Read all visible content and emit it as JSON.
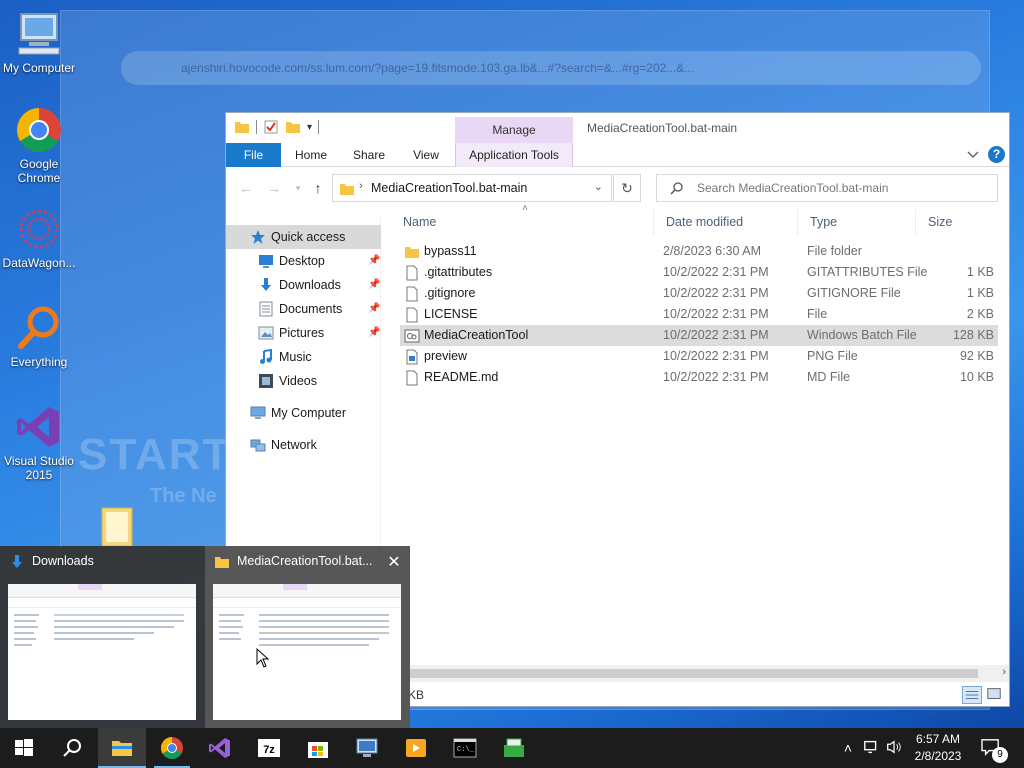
{
  "background": {
    "url_text": "ajenshiri.hovocode.com/ss.lum.com/?page=19.fitsmode.103.ga.lb&...#?search=&...#rg=202...&...",
    "watermark_line1": "START",
    "watermark_line2": "The Ne"
  },
  "desktop_icons": [
    {
      "label": "My Computer",
      "icon": "computer-icon"
    },
    {
      "label": "Google Chrome",
      "icon": "chrome-icon"
    },
    {
      "label": "DataWagon...",
      "icon": "datawagon-icon"
    },
    {
      "label": "Everything",
      "icon": "everything-search-icon"
    },
    {
      "label": "Visual Studio 2015",
      "icon": "visual-studio-icon"
    }
  ],
  "explorer": {
    "title": "MediaCreationTool.bat-main",
    "manage_tab": "Manage",
    "tabs": [
      "File",
      "Home",
      "Share",
      "View",
      "Application Tools"
    ],
    "address": "MediaCreationTool.bat-main",
    "search_placeholder": "Search MediaCreationTool.bat-main",
    "help": "?",
    "nav": {
      "quick_access": "Quick access",
      "items": [
        {
          "label": "Desktop",
          "pinned": true,
          "icon": "desktop-icon"
        },
        {
          "label": "Downloads",
          "pinned": true,
          "icon": "downloads-icon"
        },
        {
          "label": "Documents",
          "pinned": true,
          "icon": "documents-icon"
        },
        {
          "label": "Pictures",
          "pinned": true,
          "icon": "pictures-icon"
        },
        {
          "label": "Music",
          "pinned": false,
          "icon": "music-icon"
        },
        {
          "label": "Videos",
          "pinned": false,
          "icon": "videos-icon"
        }
      ],
      "my_computer": "My Computer",
      "network": "Network"
    },
    "columns": {
      "name": "Name",
      "date": "Date modified",
      "type": "Type",
      "size": "Size"
    },
    "files": [
      {
        "name": "bypass11",
        "date": "2/8/2023 6:30 AM",
        "type": "File folder",
        "size": "",
        "icon": "folder-icon",
        "selected": false
      },
      {
        "name": ".gitattributes",
        "date": "10/2/2022 2:31 PM",
        "type": "GITATTRIBUTES File",
        "size": "1 KB",
        "icon": "file-icon",
        "selected": false
      },
      {
        "name": ".gitignore",
        "date": "10/2/2022 2:31 PM",
        "type": "GITIGNORE File",
        "size": "1 KB",
        "icon": "file-icon",
        "selected": false
      },
      {
        "name": "LICENSE",
        "date": "10/2/2022 2:31 PM",
        "type": "File",
        "size": "2 KB",
        "icon": "file-icon",
        "selected": false
      },
      {
        "name": "MediaCreationTool",
        "date": "10/2/2022 2:31 PM",
        "type": "Windows Batch File",
        "size": "128 KB",
        "icon": "batch-file-icon",
        "selected": true
      },
      {
        "name": "preview",
        "date": "10/2/2022 2:31 PM",
        "type": "PNG File",
        "size": "92 KB",
        "icon": "image-file-icon",
        "selected": false
      },
      {
        "name": "README.md",
        "date": "10/2/2022 2:31 PM",
        "type": "MD File",
        "size": "10 KB",
        "icon": "file-icon",
        "selected": false
      }
    ],
    "status_text": "KB"
  },
  "previews": [
    {
      "title": "Downloads"
    },
    {
      "title": "MediaCreationTool.bat..."
    }
  ],
  "taskbar": {
    "clock_time": "6:57 AM",
    "clock_date": "2/8/2023",
    "notifications": "9",
    "apps": [
      "start-icon",
      "search-icon",
      "file-explorer-icon",
      "chrome-icon",
      "visual-studio-icon",
      "7zip-icon",
      "store-icon",
      "remote-desktop-icon",
      "media-player-icon",
      "terminal-icon",
      "network-tool-icon"
    ]
  },
  "colors": {
    "accent": "#1979ca",
    "manage_tab": "#e8d7f5",
    "taskbar": "#1c1c1c"
  }
}
